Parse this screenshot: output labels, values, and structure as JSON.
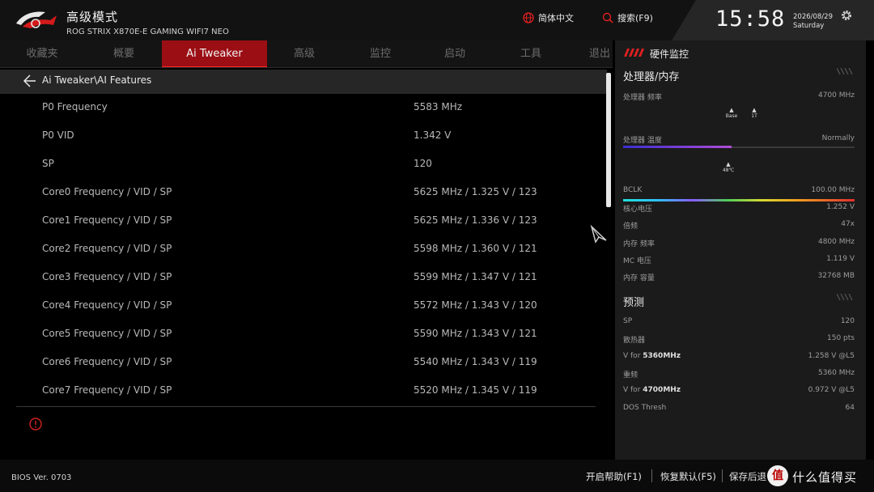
{
  "header": {
    "mode_title": "高级模式",
    "board_name": "ROG STRIX X870E-E GAMING WIFI7 NEO",
    "language_label": "简体中文",
    "search_label": "搜索(F9)",
    "time": "15:58",
    "date": "2026/08/29",
    "weekday": "Saturday"
  },
  "tabs": [
    {
      "label": "收藏夹"
    },
    {
      "label": "概要"
    },
    {
      "label": "Ai Tweaker"
    },
    {
      "label": "高级"
    },
    {
      "label": "监控"
    },
    {
      "label": "启动"
    },
    {
      "label": "工具"
    },
    {
      "label": "退出"
    }
  ],
  "active_tab": "Ai Tweaker",
  "breadcrumb": "Ai Tweaker\\AI Features",
  "settings": [
    {
      "label": "P0 Frequency",
      "value": "5583 MHz"
    },
    {
      "label": "P0 VID",
      "value": "1.342 V"
    },
    {
      "label": "SP",
      "value": "120"
    },
    {
      "label": "Core0 Frequency / VID / SP",
      "value": "5625 MHz / 1.325 V / 123"
    },
    {
      "label": "Core1 Frequency / VID / SP",
      "value": "5625 MHz / 1.336 V / 123"
    },
    {
      "label": "Core2 Frequency / VID / SP",
      "value": "5598 MHz / 1.360 V / 121"
    },
    {
      "label": "Core3 Frequency / VID / SP",
      "value": "5599 MHz / 1.347 V / 121"
    },
    {
      "label": "Core4 Frequency / VID / SP",
      "value": "5572 MHz / 1.343 V / 120"
    },
    {
      "label": "Core5 Frequency / VID / SP",
      "value": "5590 MHz / 1.343 V / 121"
    },
    {
      "label": "Core6 Frequency / VID / SP",
      "value": "5540 MHz / 1.343 V / 119"
    },
    {
      "label": "Core7 Frequency / VID / SP",
      "value": "5520 MHz / 1.345 V / 119"
    }
  ],
  "monitor": {
    "title": "硬件监控",
    "cpu_mem_section": "处理器/内存",
    "cpu_freq_label": "处理器 频率",
    "cpu_freq_value": "4700 MHz",
    "cpu_freq_level": 0.47,
    "marker_base": "Base",
    "marker_1t": "1T",
    "cpu_temp_label": "处理器 温度",
    "cpu_temp_status": "Normally",
    "cpu_temp_marker": "48℃",
    "stats": [
      {
        "label": "BCLK",
        "value": "100.00 MHz"
      },
      {
        "label": "核心电压",
        "value": "1.252 V"
      },
      {
        "label": "倍频",
        "value": "47x"
      },
      {
        "label": "内存 频率",
        "value": "4800 MHz"
      },
      {
        "label": "MC 电压",
        "value": "1.119 V"
      },
      {
        "label": "内存 容量",
        "value": "32768 MB"
      }
    ],
    "prediction_section": "预测",
    "prediction": [
      {
        "label": "SP",
        "value": "120"
      },
      {
        "label": "散热器",
        "value": "150 pts"
      },
      {
        "label_prefix": "V for ",
        "label_bold": "5360MHz",
        "value": "1.258 V @L5"
      },
      {
        "label": "重频",
        "value": "5360 MHz"
      },
      {
        "label_prefix": "V for ",
        "label_bold": "4700MHz",
        "value": "0.972 V @L5"
      },
      {
        "label": "DOS Thresh",
        "value": "64"
      }
    ]
  },
  "footer": {
    "bios_version": "BIOS Ver. 0703",
    "help_label": "开启帮助(F1)",
    "defaults_label": "恢复默认(F5)",
    "save_exit_label": "保存后退",
    "watermark": "什么值得买",
    "watermark_badge": "值"
  }
}
